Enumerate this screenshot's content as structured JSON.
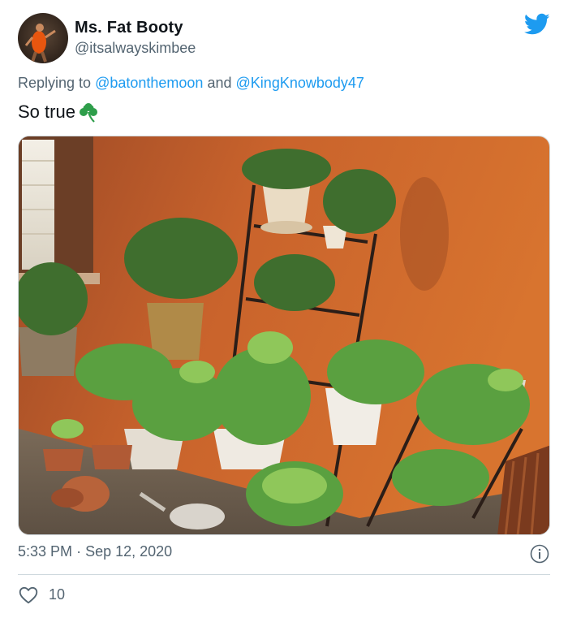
{
  "tweet": {
    "author_name": "Ms. Fat Booty",
    "author_handle": "@itsalwayskimbee",
    "replying_prefix": "Replying to",
    "replying_to": [
      "@batonthemoon",
      "@KingKnowbody47"
    ],
    "replying_joiner": "and",
    "text": "So true",
    "emoji_icon": "shamrock-icon",
    "time": "5:33 PM",
    "separator": "·",
    "date": "Sep 12, 2020",
    "like_count": "10"
  },
  "colors": {
    "brand": "#1d9bf0",
    "text_primary": "#0f1419",
    "text_secondary": "#536471",
    "divider": "#cfd9de",
    "shamrock": "#2e9e4a",
    "wall_orange": "#d06a2c"
  },
  "icons": {
    "brand_logo": "twitter-bird-icon",
    "info": "info-icon",
    "like": "heart-outline-icon"
  }
}
